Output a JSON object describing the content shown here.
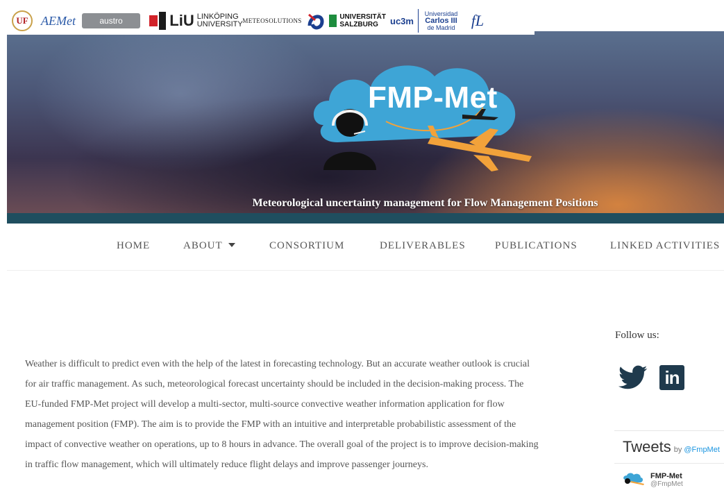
{
  "logos": {
    "uf": "UF",
    "aemet": "AEMet",
    "austro": "austro",
    "liu_mark": "LiU",
    "liu_text": [
      "LINKÖPING",
      "UNIVERSITY"
    ],
    "meteo": "METEOSOLUTIONS",
    "salzburg": [
      "UNIVERSITÄT",
      "SALZBURG"
    ],
    "uc3m": "uc3m",
    "carlos": [
      "Universidad",
      "Carlos III",
      "de Madrid"
    ],
    "fl": "fL"
  },
  "hero": {
    "title": "FMP-Met",
    "subtitle": "Meteorological uncertainty management for Flow Management Positions",
    "accent_color": "#1f4e5f"
  },
  "nav": {
    "items": [
      {
        "label": "HOME"
      },
      {
        "label": "ABOUT",
        "has_dropdown": true
      },
      {
        "label": "CONSORTIUM"
      },
      {
        "label": "DELIVERABLES"
      },
      {
        "label": "PUBLICATIONS"
      },
      {
        "label": "LINKED ACTIVITIES"
      }
    ]
  },
  "intro": {
    "text": "Weather is difficult to predict even with the help of the latest in forecasting technology. But an accurate weather outlook is crucial for air traffic management. As such, meteorological forecast uncertainty should be included in the decision-making process. The EU-funded FMP-Met project will develop a multi-sector, multi-source convective weather information application for flow management position (FMP). The aim is to provide the FMP with an intuitive and interpretable probabilistic assessment of the impact of convective weather on operations, up to 8 hours in advance. The overall goal of the project is to improve decision-making in traffic flow management, which will ultimately reduce flight delays and improve passenger journeys."
  },
  "sidebar": {
    "follow_label": "Follow us:",
    "social": [
      {
        "icon": "twitter-icon"
      },
      {
        "icon": "linkedin-icon",
        "text": "in"
      }
    ],
    "tweets": {
      "title": "Tweets",
      "by": "by",
      "handle": "@FmpMet",
      "author_name": "FMP-Met",
      "author_handle": "@FmpMet"
    }
  }
}
